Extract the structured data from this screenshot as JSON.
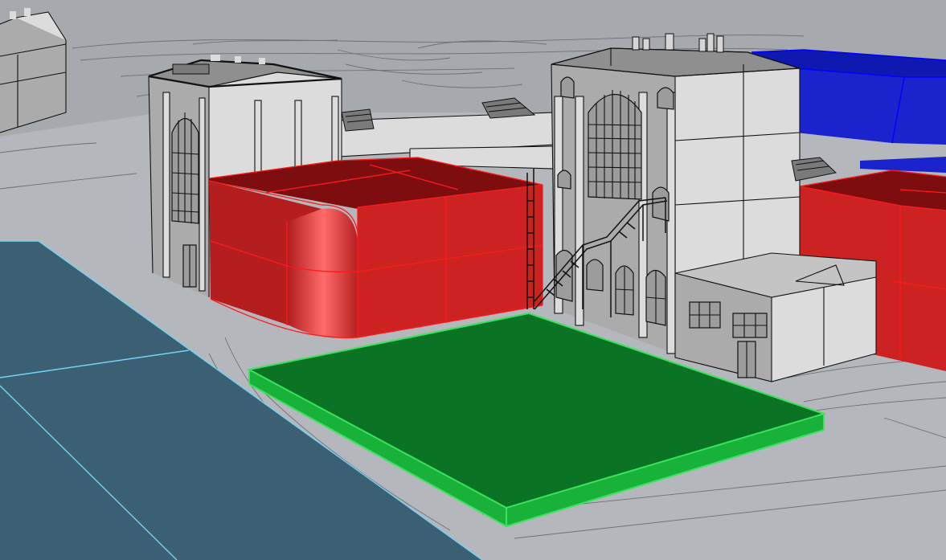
{
  "viewport": {
    "type": "rhino-3d-perspective-viewport",
    "display_mode": "shaded",
    "colors": {
      "background": "#a6a9ad",
      "ground": "#b4b7bb",
      "water": "#3c6073",
      "water_edge": "#74d2f2",
      "building_face": "#d9d9d9",
      "building_shade": "#a9a9a9",
      "outline": "#111111",
      "red_volume": "#cc2222",
      "red_volume_edge": "#ff1a1a",
      "green_slab": "#0b7424",
      "green_slab_edge": "#39e35c",
      "blue_volume": "#1b24cc",
      "blue_volume_edge": "#0000ff"
    }
  },
  "objects": [
    {
      "name": "water-plane",
      "role": "water / river surface",
      "color": "#3c6073",
      "selected": true
    },
    {
      "name": "terrain-contours",
      "role": "site context lines"
    },
    {
      "name": "distant-building",
      "role": "context building, top-left"
    },
    {
      "name": "left-hall-building",
      "role": "gabled hall with tall arched window"
    },
    {
      "name": "tower-building",
      "role": "multi-storey tower with stair and chimneys"
    },
    {
      "name": "annex-building",
      "role": "low annex with windows"
    },
    {
      "name": "red-volume-left",
      "role": "rounded massing volume",
      "color": "#cc2222",
      "selected": true
    },
    {
      "name": "red-volume-right",
      "role": "massing volume",
      "color": "#cc2222",
      "selected": true
    },
    {
      "name": "blue-volume",
      "role": "massing volume, background",
      "color": "#1b24cc",
      "selected": true
    },
    {
      "name": "green-slab",
      "role": "site slab",
      "color": "#0b7424",
      "selected": true
    }
  ]
}
